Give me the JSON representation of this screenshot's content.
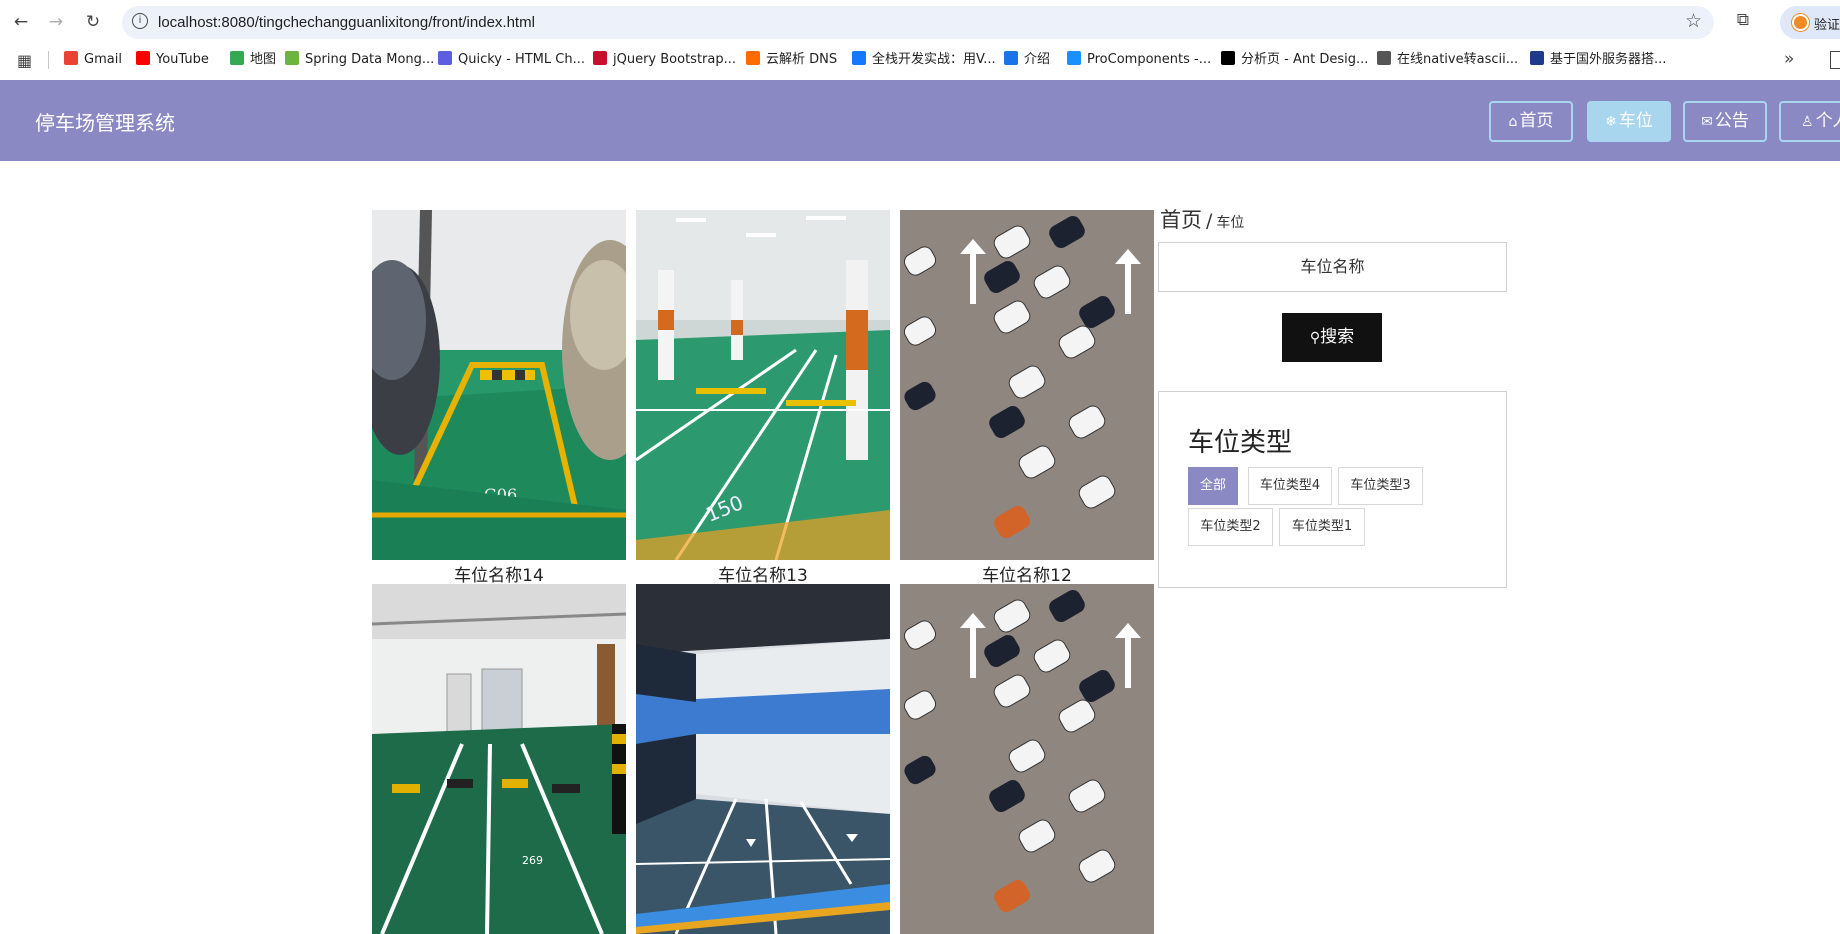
{
  "browser": {
    "url": "localhost:8080/tingchechangguanlixitong/front/index.html",
    "profile_label": "验证",
    "bookmarks": [
      {
        "label": "Gmail",
        "color": "#ea4335"
      },
      {
        "label": "YouTube",
        "color": "#ff0000"
      },
      {
        "label": "地图",
        "color": "#34a853"
      },
      {
        "label": "Spring Data Mong...",
        "color": "#6db33f"
      },
      {
        "label": "Quicky - HTML Ch...",
        "color": "#5b5fe0"
      },
      {
        "label": "jQuery Bootstrap...",
        "color": "#c8102e"
      },
      {
        "label": "云解析 DNS",
        "color": "#ff6a00"
      },
      {
        "label": "全栈开发实战：用V...",
        "color": "#1677ff"
      },
      {
        "label": "介绍",
        "color": "#1a73e8"
      },
      {
        "label": "ProComponents -...",
        "color": "#1890ff"
      },
      {
        "label": "分析页 - Ant Desig...",
        "color": "#000000"
      },
      {
        "label": "在线native转ascii...",
        "color": "#555555"
      },
      {
        "label": "基于国外服务器搭...",
        "color": "#1e3a8a"
      }
    ]
  },
  "header": {
    "title": "停车场管理系统",
    "nav": [
      {
        "label": "首页",
        "icon": "home-icon",
        "active": false
      },
      {
        "label": "车位",
        "icon": "snowflake-icon",
        "active": true
      },
      {
        "label": "公告",
        "icon": "mail-icon",
        "active": false
      },
      {
        "label": "个人",
        "icon": "user-icon",
        "active": false
      }
    ]
  },
  "breadcrumb": {
    "home": "首页",
    "separator": "/",
    "current": "车位"
  },
  "search": {
    "placeholder": "车位名称",
    "button_label": "搜索"
  },
  "type_filter": {
    "title": "车位类型",
    "tags": [
      {
        "label": "全部",
        "selected": true
      },
      {
        "label": "车位类型4",
        "selected": false
      },
      {
        "label": "车位类型3",
        "selected": false
      },
      {
        "label": "车位类型2",
        "selected": false
      },
      {
        "label": "车位类型1",
        "selected": false
      }
    ]
  },
  "spots": [
    {
      "name": "车位名称14",
      "photo": "green-garage-spot-G06",
      "marking": "G06"
    },
    {
      "name": "车位名称13",
      "photo": "underground-lot-green-floor",
      "marking": "150"
    },
    {
      "name": "车位名称12",
      "photo": "aerial-cars-parked"
    },
    {
      "name": "",
      "photo": "white-garage-green-floor",
      "marking": "269"
    },
    {
      "name": "",
      "photo": "blue-stripe-garage"
    },
    {
      "name": "",
      "photo": "aerial-cars-parked"
    }
  ],
  "colors": {
    "header_bg": "#8b89c3",
    "nav_border": "#a8d6ee",
    "tag_selected": "#8b89c3",
    "search_button": "#111111"
  }
}
